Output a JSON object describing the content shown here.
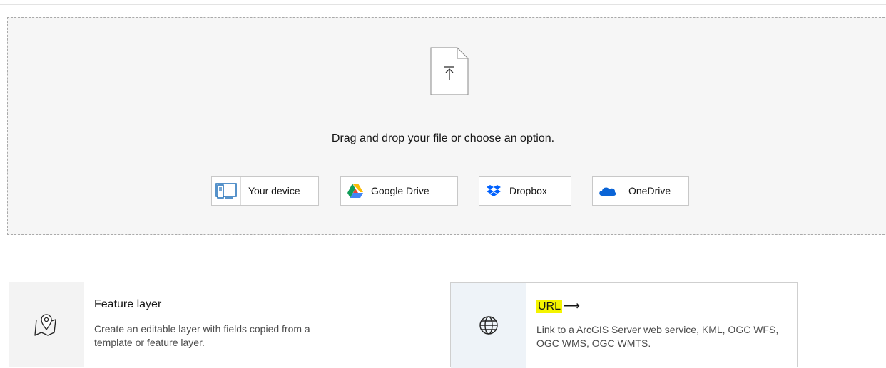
{
  "dropzone": {
    "prompt": "Drag and drop your file or choose an option.",
    "sources": [
      {
        "label": "Your device",
        "icon": "device-icon"
      },
      {
        "label": "Google Drive",
        "icon": "google-drive-icon"
      },
      {
        "label": "Dropbox",
        "icon": "dropbox-icon"
      },
      {
        "label": "OneDrive",
        "icon": "onedrive-icon"
      }
    ]
  },
  "cards": [
    {
      "title": "Feature layer",
      "description": "Create an editable layer with fields copied from a template or feature layer.",
      "icon": "map-pin-icon"
    },
    {
      "title": "URL",
      "arrow": "⟶",
      "description": "Link to a ArcGIS Server web service, KML, OGC WFS, OGC WMS, OGC WMTS.",
      "icon": "globe-icon",
      "highlight_color": "#f4f400"
    }
  ]
}
